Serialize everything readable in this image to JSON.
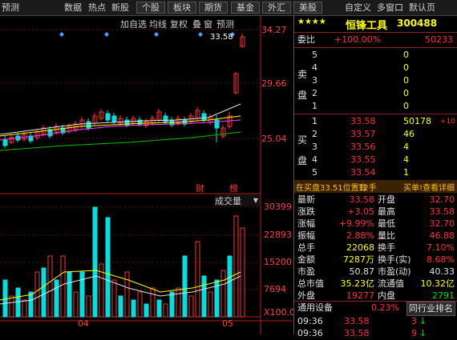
{
  "toolbar": {
    "items": [
      {
        "label": "预测"
      },
      {
        "label": "数据"
      },
      {
        "label": "热点"
      },
      {
        "label": "新股"
      },
      {
        "label": "个股"
      },
      {
        "label": "板块"
      },
      {
        "label": "期货"
      },
      {
        "label": "基金"
      },
      {
        "label": "外汇"
      },
      {
        "label": "美股"
      },
      {
        "label": "自定义"
      },
      {
        "label": "多窗口"
      },
      {
        "label": "默认页"
      }
    ]
  },
  "chart_tabs": {
    "add": "加自选",
    "ma": "均线",
    "replay": "复权",
    "overlay": "叠",
    "window": "窗",
    "forecast": "预测"
  },
  "kline": {
    "y_labels": [
      "34.27",
      "29.66",
      "25.04"
    ],
    "last_price_label": "33.58",
    "markers": {
      "cai": "财",
      "bang": "榜"
    }
  },
  "volume": {
    "selector_label": "成交量",
    "y_labels": [
      "30399",
      "22893",
      "15200",
      "7694",
      "X100.0"
    ],
    "x_labels": [
      "04",
      "05"
    ]
  },
  "quote": {
    "stars": "★★★★",
    "name": "恒锋工具",
    "code": "300488",
    "weibi_label": "委比",
    "weibi_pct": "+100.00%",
    "weibi_val": "50233",
    "sell_label": "卖盘",
    "sell": [
      {
        "level": "5",
        "price": "",
        "vol": "0"
      },
      {
        "level": "4",
        "price": "",
        "vol": "0"
      },
      {
        "level": "3",
        "price": "",
        "vol": "0"
      },
      {
        "level": "2",
        "price": "",
        "vol": "0"
      },
      {
        "level": "1",
        "price": "",
        "vol": "0"
      }
    ],
    "buy_label": "买盘",
    "buy": [
      {
        "level": "1",
        "price": "33.58",
        "vol": "50178",
        "chg": "+10"
      },
      {
        "level": "2",
        "price": "33.57",
        "vol": "46",
        "chg": ""
      },
      {
        "level": "3",
        "price": "33.56",
        "vol": "4",
        "chg": ""
      },
      {
        "level": "4",
        "price": "33.55",
        "vol": "4",
        "chg": ""
      },
      {
        "level": "5",
        "price": "33.54",
        "vol": "1",
        "chg": ""
      }
    ],
    "banner_left": "在买盘33.51位置有",
    "banner_mid": "12手",
    "banner_right": "买单!查看详细",
    "stats": [
      {
        "l1": "最新",
        "v1": "33.58",
        "c1": "red",
        "l2": "开盘",
        "v2": "32.70",
        "c2": "red"
      },
      {
        "l1": "涨跌",
        "v1": "+3.05",
        "c1": "red",
        "l2": "最高",
        "v2": "33.58",
        "c2": "red"
      },
      {
        "l1": "涨幅",
        "v1": "+9.99%",
        "c1": "red",
        "l2": "最低",
        "v2": "32.70",
        "c2": "red"
      },
      {
        "l1": "振幅",
        "v1": "2.88%",
        "c1": "red",
        "l2": "量比",
        "v2": "46.88",
        "c2": "red"
      },
      {
        "l1": "总手",
        "v1": "22068",
        "c1": "yellow",
        "l2": "换手",
        "v2": "7.10%",
        "c2": "red"
      },
      {
        "l1": "金额",
        "v1": "7287万",
        "c1": "yellow",
        "l2": "换手(实)",
        "v2": "8.68%",
        "c2": "red"
      },
      {
        "l1": "市盈",
        "v1": "50.87",
        "c1": "white",
        "l2": "市盈(动)",
        "v2": "40.33",
        "c2": "white"
      },
      {
        "l1": "总市值",
        "v1": "35.23亿",
        "c1": "yellow",
        "l2": "流通值",
        "v2": "10.32亿",
        "c2": "yellow"
      },
      {
        "l1": "外盘",
        "v1": "19277",
        "c1": "red",
        "l2": "内盘",
        "v2": "2791",
        "c2": "green"
      }
    ],
    "industry": "通用设备",
    "industry_pct": "0.23%",
    "industry_rank": "同行业排名",
    "ticks": [
      {
        "time": "09:36",
        "price": "33.58",
        "vol": "3"
      },
      {
        "time": "09:36",
        "price": "33.58",
        "vol": "9"
      }
    ]
  }
}
